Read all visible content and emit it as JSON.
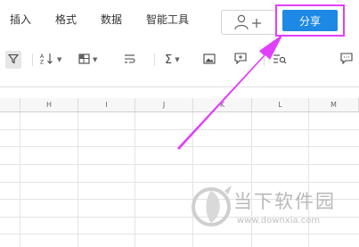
{
  "menubar": {
    "items": [
      "插入",
      "格式",
      "数据",
      "智能工具"
    ],
    "collaborate_icon": "add-person-icon",
    "share_label": "分享"
  },
  "toolbar": {
    "icons": [
      "filter-icon",
      "sort-icon",
      "freeze-icon",
      "wrap-text-icon",
      "sum-icon",
      "image-icon",
      "comment-icon",
      "find-icon",
      "message-icon"
    ]
  },
  "sheet": {
    "columns": [
      "H",
      "I",
      "J",
      "K",
      "L",
      "M"
    ]
  },
  "watermark": {
    "title": "当下软件园",
    "url": "www.downxia.com"
  },
  "colors": {
    "share_button": "#1e88e5",
    "highlight": "#e040fb",
    "grid_line": "#e3e3e3"
  }
}
